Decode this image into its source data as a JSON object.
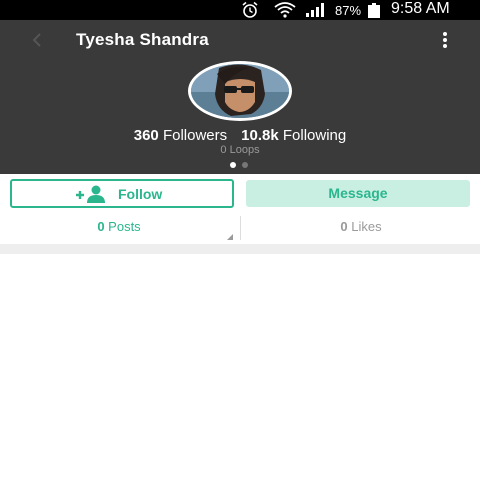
{
  "status_bar": {
    "battery_percent": "87%",
    "time": "9:58 AM",
    "icons": [
      "alarm-icon",
      "wifi-icon",
      "signal-icon",
      "battery-icon"
    ]
  },
  "header": {
    "name": "Tyesha Shandra",
    "back_icon": "chevron-left-icon",
    "menu_icon": "more-vertical-icon",
    "followers_count": "360",
    "followers_label": "Followers",
    "following_count": "10.8k",
    "following_label": "Following",
    "loops_text": "0 Loops",
    "pager": {
      "total": 2,
      "active": 1
    }
  },
  "actions": {
    "follow_label": "Follow",
    "message_label": "Message"
  },
  "tabs": {
    "posts_count": "0",
    "posts_label": "Posts",
    "likes_count": "0",
    "likes_label": "Likes"
  },
  "colors": {
    "accent": "#2bb68e",
    "header_bg": "#3a3a3a",
    "message_bg": "#c9efe2",
    "status_bar_bg": "#000000"
  }
}
